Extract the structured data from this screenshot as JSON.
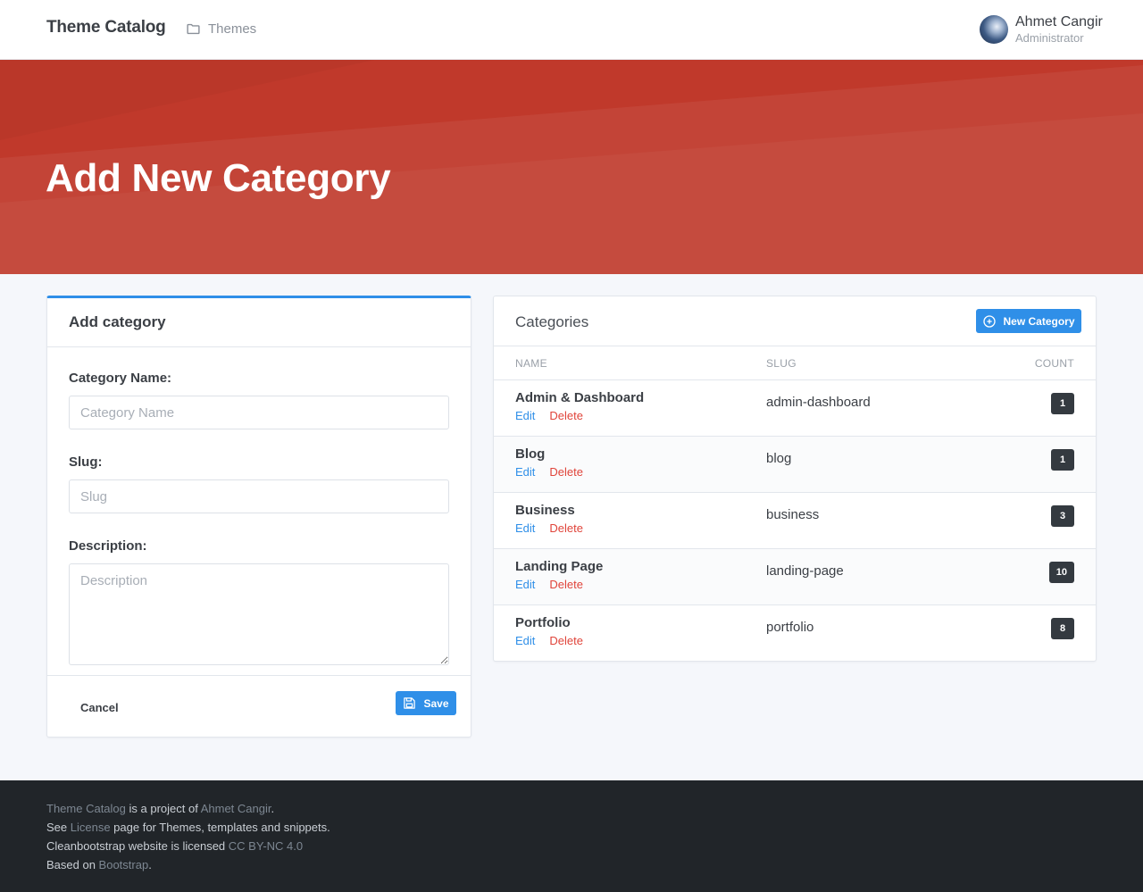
{
  "header": {
    "brand": "Theme Catalog",
    "nav_item": "Themes",
    "user_name": "Ahmet Cangir",
    "user_role": "Administrator"
  },
  "hero": {
    "title": "Add New Category",
    "color": "#c0392b"
  },
  "add_form": {
    "title": "Add category",
    "name_label": "Category Name:",
    "name_placeholder": "Category Name",
    "name_value": "",
    "slug_label": "Slug:",
    "slug_placeholder": "Slug",
    "slug_value": "",
    "description_label": "Description:",
    "description_placeholder": "Description",
    "description_value": "",
    "cancel_label": "Cancel",
    "save_label": "Save",
    "save_icon": "save-icon"
  },
  "categories": {
    "title": "Categories",
    "new_button": "New Category",
    "new_icon": "plus-circle-icon",
    "columns": [
      "NAME",
      "SLUG",
      "COUNT"
    ],
    "edit_label": "Edit",
    "delete_label": "Delete",
    "rows": [
      {
        "name": "Admin & Dashboard",
        "slug": "admin-dashboard",
        "count": "1"
      },
      {
        "name": "Blog",
        "slug": "blog",
        "count": "1"
      },
      {
        "name": "Business",
        "slug": "business",
        "count": "3"
      },
      {
        "name": "Landing Page",
        "slug": "landing-page",
        "count": "10"
      },
      {
        "name": "Portfolio",
        "slug": "portfolio",
        "count": "8"
      }
    ]
  },
  "footer": {
    "line1_link1": "Theme Catalog",
    "line1_text": " is a project of ",
    "line1_link2": "Ahmet Cangir",
    "line1_end": ".",
    "line2_start": "See ",
    "line2_link": "License",
    "line2_text": " page for Themes, templates and snippets.",
    "line3_text": "Cleanbootstrap website is licensed ",
    "line3_link": "CC BY-NC 4.0",
    "line4_start": "Based on ",
    "line4_link": "Bootstrap",
    "line4_end": "."
  },
  "colors": {
    "accent": "#2f8fe8",
    "delete": "#e0443a",
    "footer_bg": "#212529"
  }
}
